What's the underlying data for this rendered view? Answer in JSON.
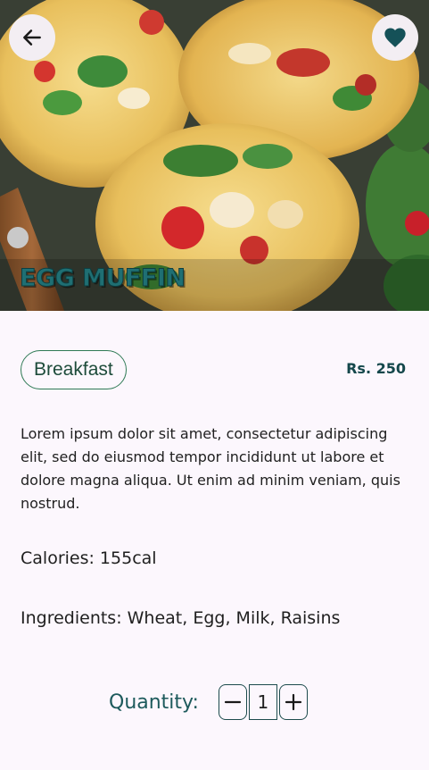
{
  "header": {
    "back_icon": "arrow-left-icon",
    "favorite_icon": "heart-icon",
    "title": "EGG MUFFIN"
  },
  "details": {
    "category": "Breakfast",
    "price": "Rs. 250",
    "description": "Lorem ipsum dolor sit amet, consectetur adipiscing elit, sed do eiusmod tempor incididunt ut labore et dolore magna aliqua. Ut enim ad minim veniam, quis nostrud.",
    "calories": "Calories: 155cal",
    "ingredients": "Ingredients: Wheat, Egg, Milk, Raisins"
  },
  "quantity": {
    "label": "Quantity:",
    "value": "1",
    "decrement_icon": "minus-icon",
    "increment_icon": "plus-icon"
  },
  "colors": {
    "accent": "#1d5a5c",
    "title_teal": "#1f6f73",
    "chip_border": "#2f7a55",
    "heart": "#155158",
    "background": "#fcf7fd"
  }
}
